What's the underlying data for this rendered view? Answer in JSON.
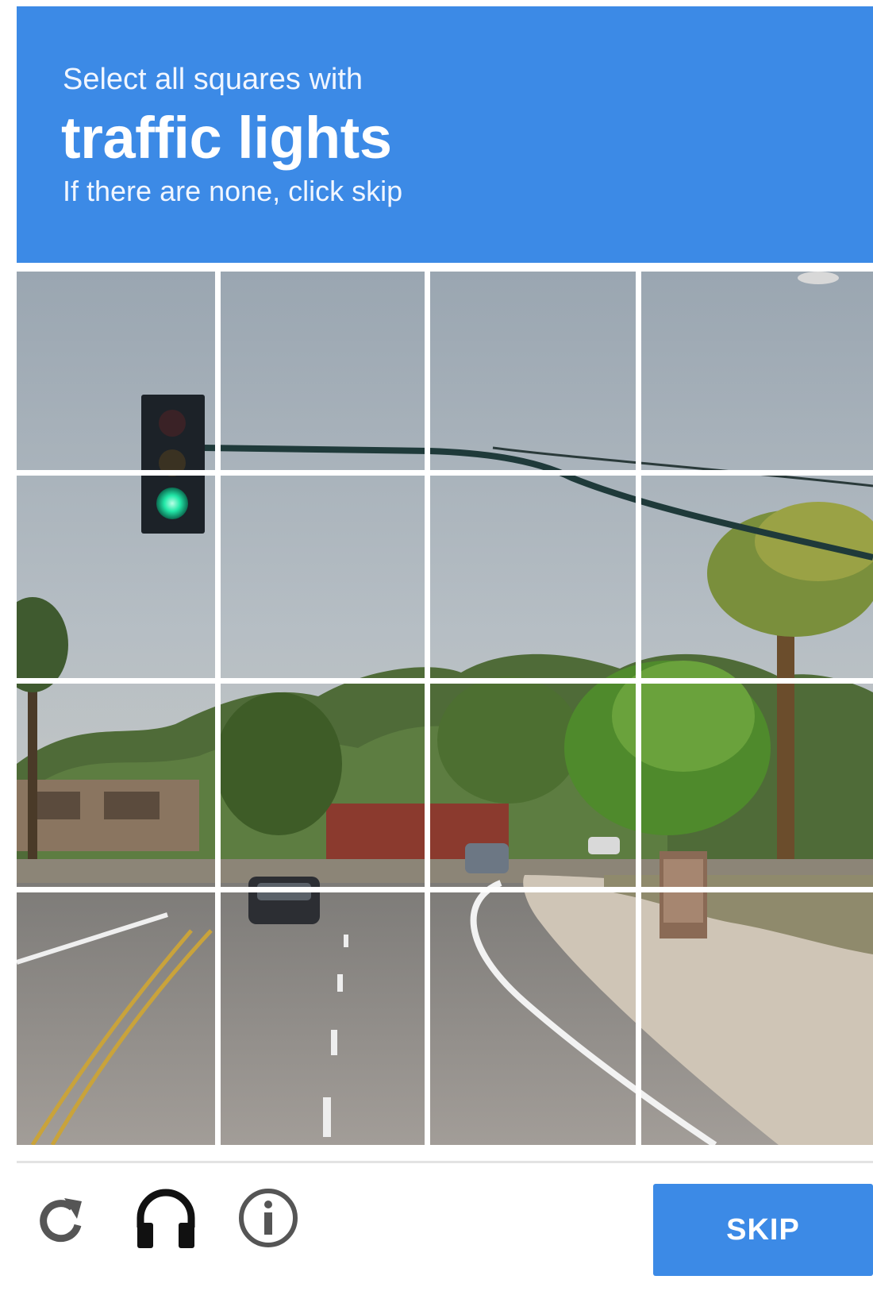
{
  "header": {
    "instruction": "Select all squares with",
    "target": "traffic lights",
    "hint": "If there are none, click skip"
  },
  "grid": {
    "rows": 4,
    "cols": 4,
    "selected_tiles": []
  },
  "footer": {
    "reload_icon": "reload-icon",
    "audio_icon": "headphones-icon",
    "info_icon": "info-icon",
    "skip_label": "SKIP"
  },
  "colors": {
    "accent": "#3c8ae6",
    "icon_gray": "#555555"
  }
}
